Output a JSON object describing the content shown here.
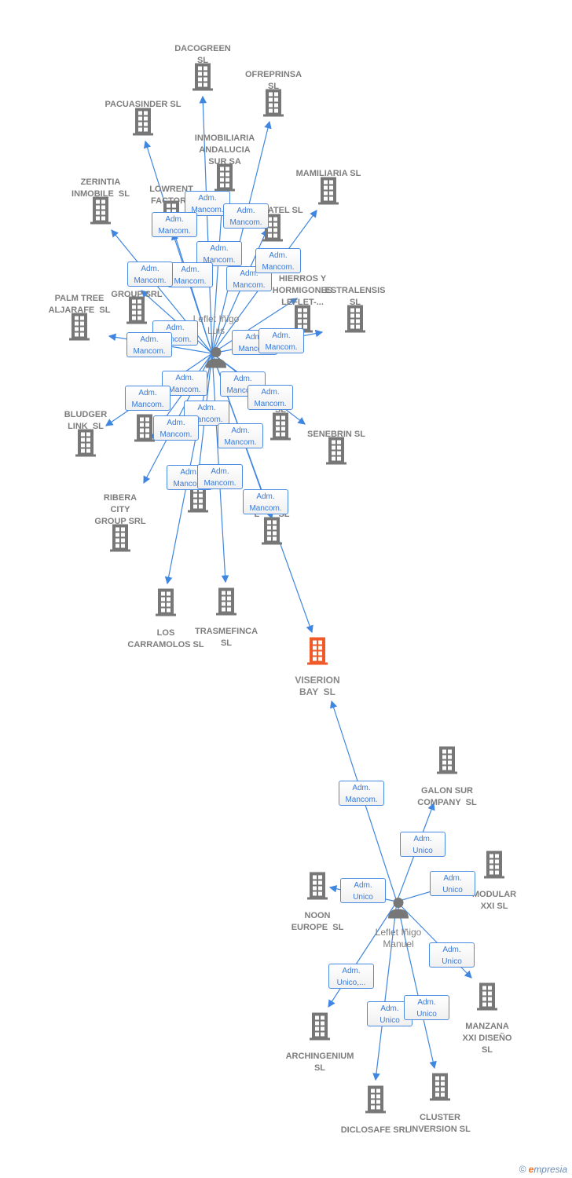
{
  "colors": {
    "edge": "#3f86e0",
    "building": "#777777",
    "focus": "#f05a28",
    "person": "#777777"
  },
  "persons": [
    {
      "name": "Leflet Iñigo\nLuis"
    },
    {
      "name": "Leflet Iñigo\nManuel"
    }
  ],
  "companies": [
    {
      "name": "DACOGREEN\nSL"
    },
    {
      "name": "OFREPRINSA\nSL"
    },
    {
      "name": "PACUASINDER SL"
    },
    {
      "name": "INMOBILIARIA\nANDALUCIA\nSUR SA"
    },
    {
      "name": "MAMILIARIA SL"
    },
    {
      "name": "ZERINTIA\nINMOBILE  SL"
    },
    {
      "name": "LOWRENT\nFACTORY"
    },
    {
      "name": "ROCAATEL SL"
    },
    {
      "name": "ES\nBU\nGROUP SRL"
    },
    {
      "name": "PALM TREE\nALJARAFE  SL"
    },
    {
      "name": "HIERROS Y\nHORMIGONES\nLEFLET-..."
    },
    {
      "name": "ESTRALENSIS\nSL"
    },
    {
      "name": "FE"
    },
    {
      "name": "BLUDGER\nLINK  SL"
    },
    {
      "name": "N\nSL"
    },
    {
      "name": "SENEBRIN SL"
    },
    {
      "name": "RIBERA\nCITY\nGROUP SRL"
    },
    {
      "name": "PROPERTY"
    },
    {
      "name": "L        SL"
    },
    {
      "name": "LOS\nCARRAMOLOS SL"
    },
    {
      "name": "TRASMEFINCA\nSL"
    },
    {
      "name": "VISERION\nBAY  SL",
      "focus": true
    },
    {
      "name": "GALON SUR\nCOMPANY  SL"
    },
    {
      "name": "MODULAR\nXXI SL"
    },
    {
      "name": "NOON\nEUROPE  SL"
    },
    {
      "name": "MANZANA\nXXI DISEÑO\nSL"
    },
    {
      "name": "ARCHINGENIUM\nSL"
    },
    {
      "name": "DICLOSAFE SRL"
    },
    {
      "name": "CLUSTER\nINVERSION SL"
    }
  ],
  "roles": [
    "Adm.\nMancom.",
    "Adm.\nMancom.",
    "Adm.\nMancom.",
    "Adm.\nMancom.",
    "Adm.\nMancom.",
    "Adm.\nMancom.",
    "Adm.\nMancom.",
    "Adm.\nMancom.",
    "Adm.\nMancom.",
    "Adm.\nMancom.",
    "Adm.\nMancom.",
    "Adm.\nMancom.",
    "Adm.\nMancom.",
    "Adm.\nMancom.",
    "Adm.\nMancom.",
    "Adm.\nMancom.",
    "Adm.\nMancom.",
    "Adm.\nMancom.",
    "Adm.\nMancom.",
    "Adm.\nMancom.",
    "Adm.\nMancom.",
    "Adm.\nMancom.",
    "Adm.\nMancom.",
    "Adm.\nUnico",
    "Adm.\nUnico",
    "Adm.\nUnico",
    "Adm.\nUnico",
    "Adm.\nUnico,...",
    "Adm.\nUnico",
    "Adm.\nUnico"
  ],
  "footer": {
    "copyright": "©",
    "brand_e": "e",
    "brand_rest": "mpresia"
  }
}
